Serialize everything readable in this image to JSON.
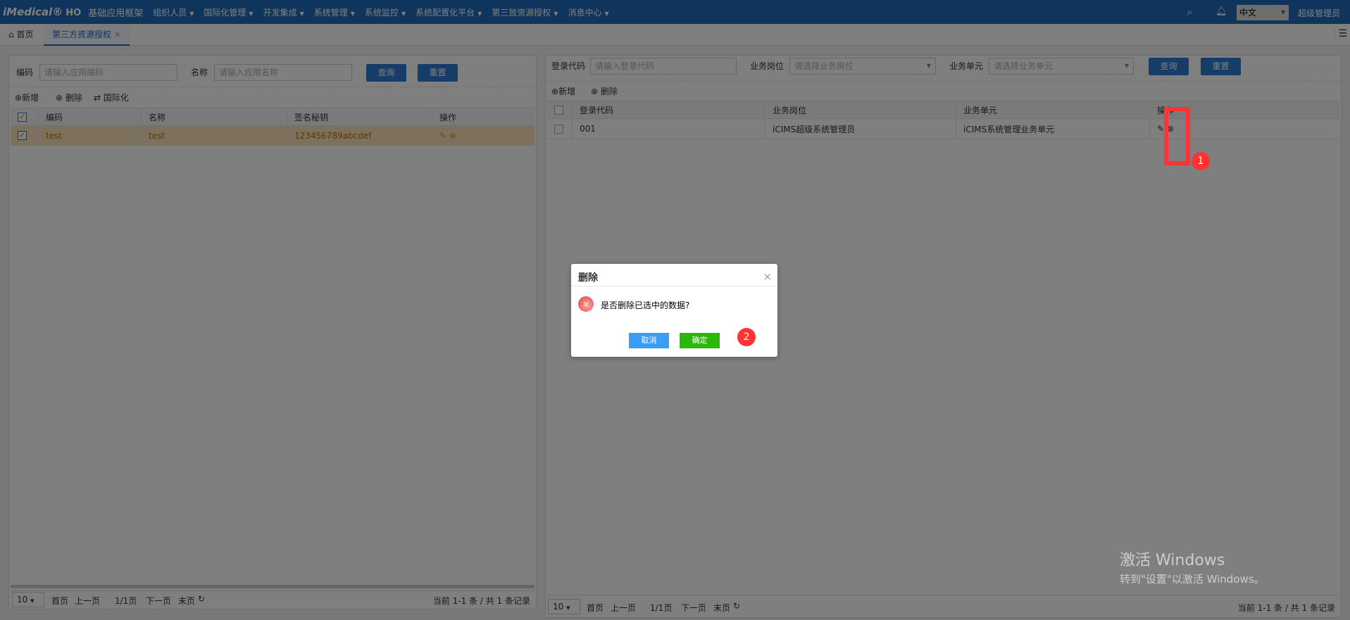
{
  "header": {
    "logo": "iMedical®",
    "logo_suffix": "HO",
    "app_title": "基础应用框架",
    "menus": [
      "组织人员",
      "国际化管理",
      "开发集成",
      "系统管理",
      "系统监控",
      "系统配置化平台",
      "第三放资源授权",
      "消息中心"
    ],
    "language": "中文",
    "user": "超级管理员"
  },
  "tabs": [
    {
      "label": "首页"
    },
    {
      "label": "第三方资源授权"
    }
  ],
  "left": {
    "code_label": "编码",
    "code_placeholder": "请输入应用编码",
    "name_label": "名称",
    "name_placeholder": "请输入应用名称",
    "query": "查询",
    "reset": "重置",
    "toolbar": [
      "新增",
      "删除",
      "国际化"
    ],
    "columns": [
      "编码",
      "名称",
      "签名秘钥",
      "操作"
    ],
    "rows": [
      {
        "code": "test",
        "name": "test",
        "secret": "123456789abcdef"
      }
    ],
    "page_size": "10",
    "first": "首页",
    "prev": "上一页",
    "page": "1/1页",
    "next": "下一页",
    "last": "末页",
    "summary": "当前 1-1 条 / 共 1 条记录"
  },
  "right": {
    "login_label": "登录代码",
    "login_placeholder": "请输入登录代码",
    "post_label": "业务岗位",
    "post_placeholder": "请选择业务岗位",
    "unit_label": "业务单元",
    "unit_placeholder": "请选择业务单元",
    "query": "查询",
    "reset": "重置",
    "toolbar": [
      "新增",
      "删除"
    ],
    "columns": [
      "登录代码",
      "业务岗位",
      "业务单元",
      "操作"
    ],
    "rows": [
      {
        "login": "001",
        "post": "iCIMS超级系统管理员",
        "unit": "iCIMS系统管理业务单元"
      }
    ],
    "page_size": "10",
    "first": "首页",
    "prev": "上一页",
    "page": "1/1页",
    "next": "下一页",
    "last": "末页",
    "summary": "当前 1-1 条 / 共 1 条记录"
  },
  "dialog": {
    "title": "删除",
    "message": "是否删除已选中的数据?",
    "cancel": "取消",
    "ok": "确定"
  },
  "annotations": [
    "1",
    "2"
  ],
  "watermark": {
    "line1": "激活 Windows",
    "line2": "转到\"设置\"以激活 Windows。"
  }
}
